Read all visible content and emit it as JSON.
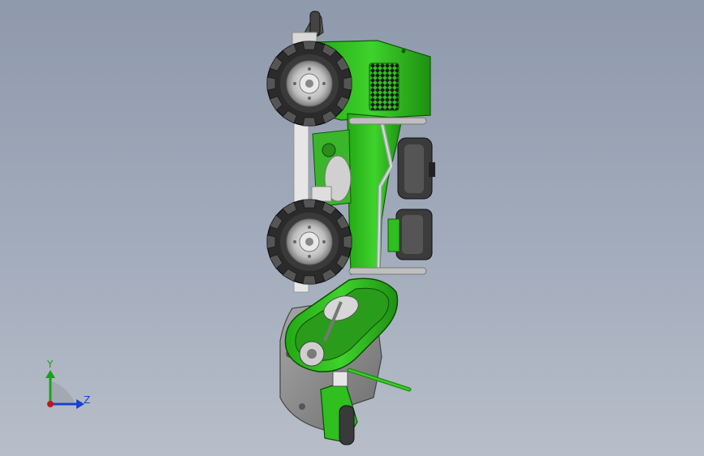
{
  "view": {
    "background_top": "#8e99ab",
    "background_bottom": "#b7bec9"
  },
  "model": {
    "primary_color": "#2fbf1f",
    "dark_green": "#1e8f12",
    "metal_color": "#8a8a8a",
    "tire_color": "#2b2b2b",
    "wheel_count": 2
  },
  "triad": {
    "y_label": "Y",
    "z_label": "Z",
    "y_color": "#1aa01a",
    "z_color": "#1a40d0",
    "origin_color": "#c01818"
  }
}
